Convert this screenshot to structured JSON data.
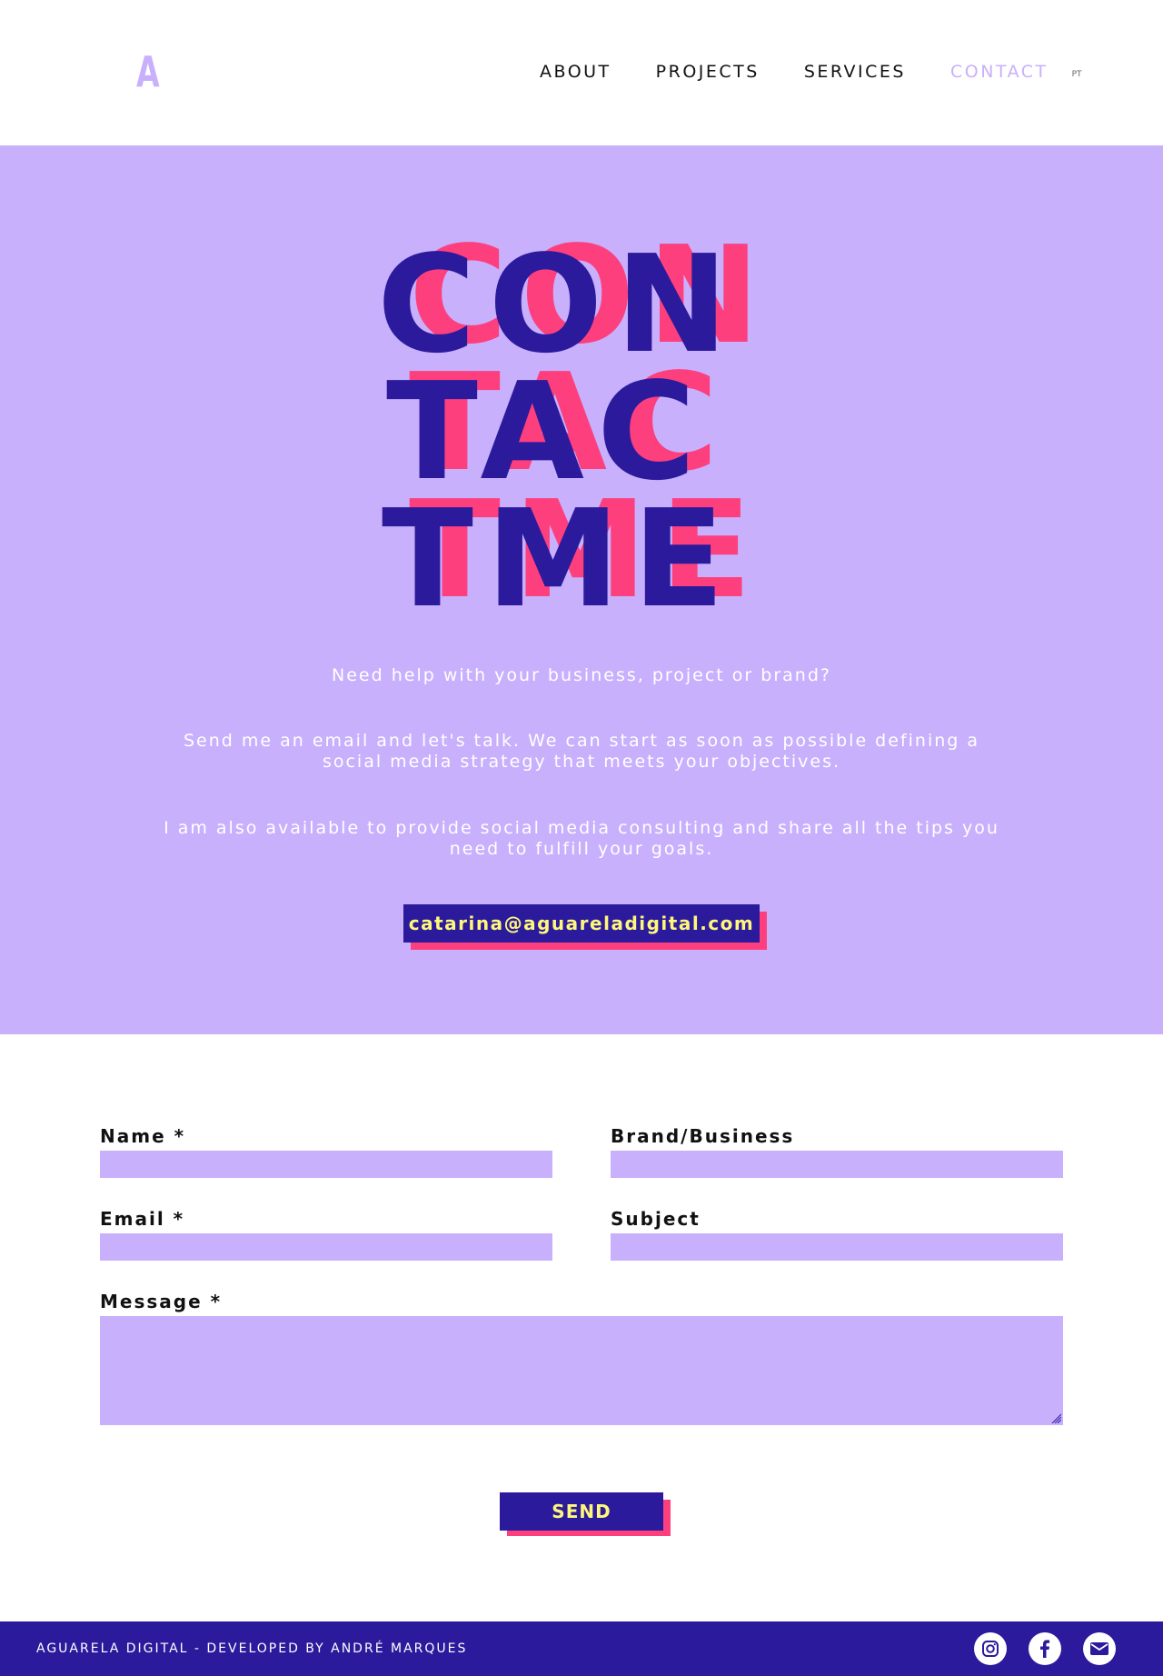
{
  "header": {
    "logo": "A",
    "nav": [
      {
        "label": "ABOUT"
      },
      {
        "label": "PROJECTS"
      },
      {
        "label": "SERVICES"
      },
      {
        "label": "CONTACT",
        "active": true
      }
    ],
    "lang": "PT"
  },
  "hero": {
    "title_lines": [
      "CON",
      "TAC",
      "TME"
    ],
    "paragraphs": [
      "Need help with your business, project or brand?",
      "Send me an email and let's talk. We can start as soon as possible defining a social media strategy that meets your objectives.",
      "I am also available to provide social media consulting and share all the tips you need to fulfill your goals."
    ],
    "email": "catarina@aguareladigital.com"
  },
  "form": {
    "name_label": "Name *",
    "brand_label": "Brand/Business",
    "email_label": "Email *",
    "subject_label": "Subject",
    "message_label": "Message *",
    "send_label": "SEND"
  },
  "footer": {
    "text": "AGUARELA DIGITAL - DEVELOPED BY ANDRÉ MARQUES",
    "socials": [
      "instagram-icon",
      "facebook-icon",
      "email-icon"
    ]
  },
  "colors": {
    "lavender": "#c8b0fd",
    "navy": "#2b1a9c",
    "pink": "#fd3f7e",
    "yellow": "#fff77a"
  }
}
